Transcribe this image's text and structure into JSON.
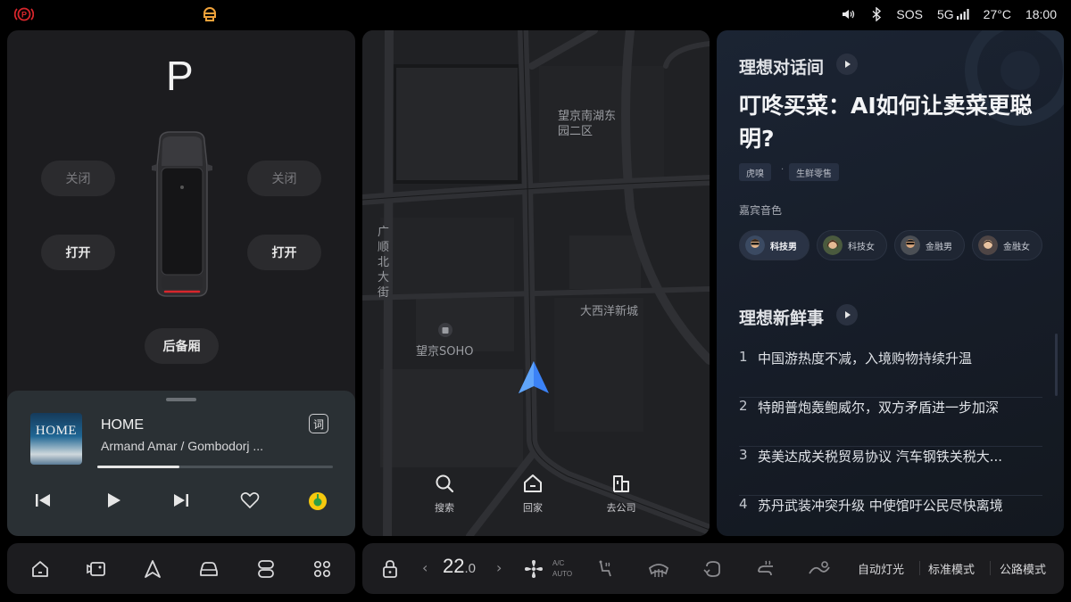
{
  "status_bar": {
    "left_icons": [
      "parking-brake-icon",
      "driver-monitor-icon"
    ],
    "sos": "SOS",
    "network": "5G",
    "temperature": "27°C",
    "time": "18:00",
    "accent_red": "#d8262c",
    "accent_orange": "#f0a23a"
  },
  "vehicle": {
    "gear": "P",
    "left_close": "关闭",
    "right_close": "关闭",
    "left_open": "打开",
    "right_open": "打开",
    "trunk": "后备厢"
  },
  "music": {
    "album_art_text": "HOME",
    "title": "HOME",
    "artist": "Armand Amar / Gombodorj ...",
    "lyrics_button": "词",
    "progress": 0.35
  },
  "map": {
    "labels": {
      "area1": "望京南湖东园二区",
      "road": "广顺北大街",
      "poi": "望京SOHO",
      "area2": "大西洋新城"
    },
    "buttons": {
      "search": "搜索",
      "home": "回家",
      "work": "去公司"
    },
    "nav_color": "#3b82f6"
  },
  "content": {
    "section1_title": "理想对话间",
    "headline": "叮咚买菜：AI如何让卖菜更聪明?",
    "tags": [
      "虎嗅",
      "生鲜零售"
    ],
    "guest_label": "嘉宾音色",
    "voices": [
      "科技男",
      "科技女",
      "金融男",
      "金融女"
    ],
    "section2_title": "理想新鲜事",
    "news": [
      {
        "n": "1",
        "t": "中国游热度不减，入境购物持续升温"
      },
      {
        "n": "2",
        "t": "特朗普炮轰鲍威尔，双方矛盾进一步加深"
      },
      {
        "n": "3",
        "t": "英美达成关税贸易协议 汽车钢铁关税大..."
      },
      {
        "n": "4",
        "t": "苏丹武装冲突升级 中使馆吁公民尽快离境"
      }
    ]
  },
  "climate": {
    "temperature": "22",
    "temperature_decimal": ".0",
    "ac_label_top": "A/C",
    "ac_label_bottom": "AUTO",
    "lights": "自动灯光",
    "mode": "标准模式",
    "road_mode": "公路模式"
  }
}
